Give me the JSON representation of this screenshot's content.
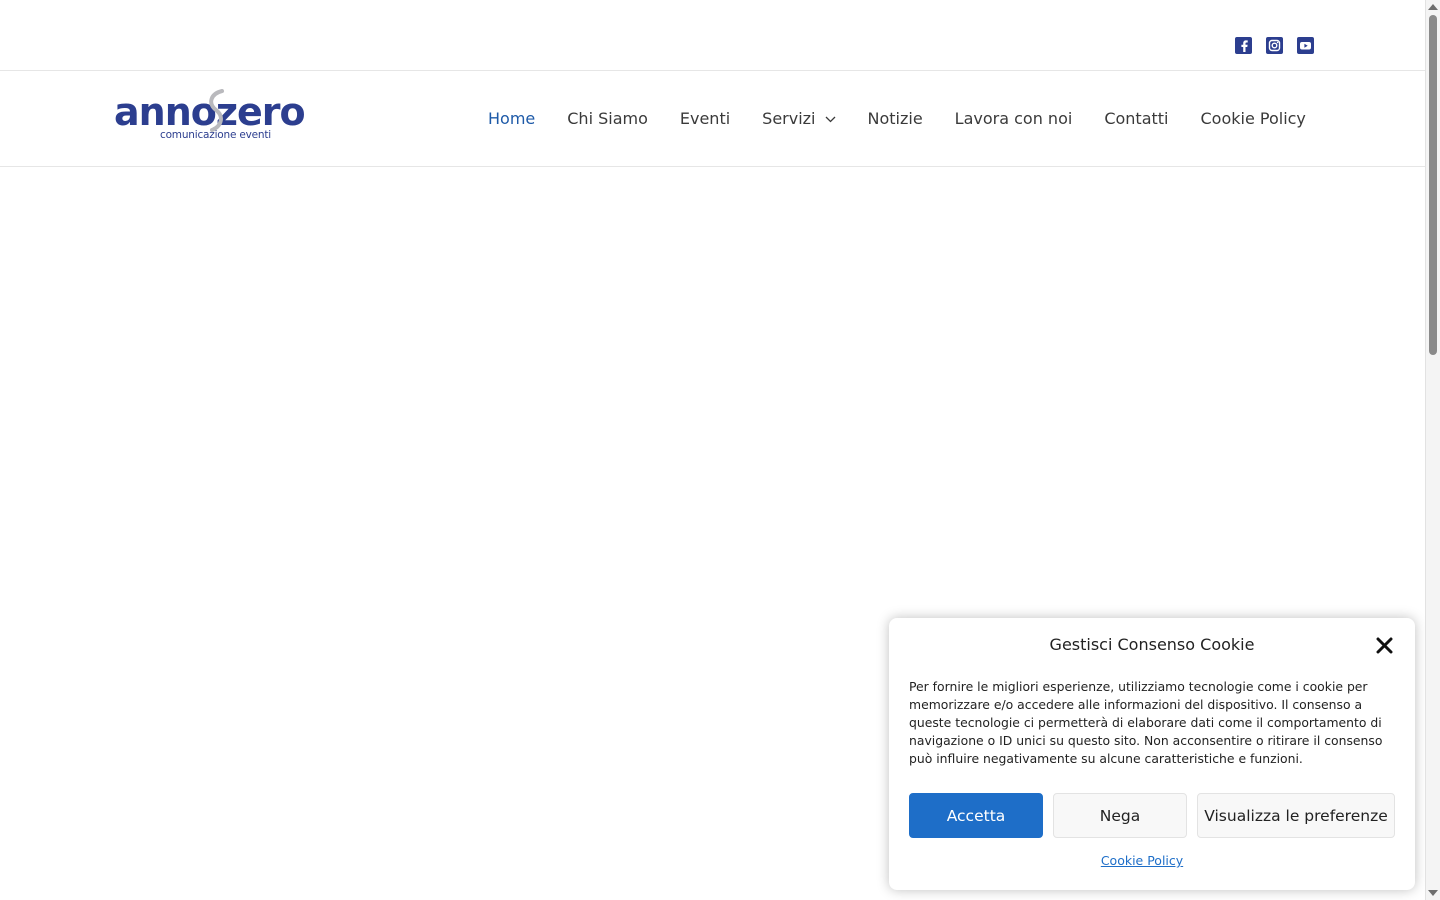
{
  "social": {
    "icons": [
      "facebook-icon",
      "instagram-icon",
      "youtube-icon"
    ],
    "color": "#2c3e8f"
  },
  "logo": {
    "wordmark": "annozero",
    "tagline": "comunicazione eventi"
  },
  "nav": {
    "items": [
      {
        "label": "Home",
        "active": true
      },
      {
        "label": "Chi Siamo"
      },
      {
        "label": "Eventi"
      },
      {
        "label": "Servizi",
        "has_dropdown": true
      },
      {
        "label": "Notizie"
      },
      {
        "label": "Lavora con noi"
      },
      {
        "label": "Contatti"
      },
      {
        "label": "Cookie Policy"
      }
    ],
    "active_color": "#1e5aa8"
  },
  "cookie_dialog": {
    "title": "Gestisci Consenso Cookie",
    "body": "Per fornire le migliori esperienze, utilizziamo tecnologie come i cookie per memorizzare e/o accedere alle informazioni del dispositivo. Il consenso a queste tecnologie ci permetterà di elaborare dati come il comportamento di navigazione o ID unici su questo sito. Non acconsentire o ritirare il consenso può influire negativamente su alcune caratteristiche e funzioni.",
    "accept_label": "Accetta",
    "deny_label": "Nega",
    "prefs_label": "Visualizza le preferenze",
    "policy_link": "Cookie Policy",
    "accent": "#1e6ec8"
  }
}
